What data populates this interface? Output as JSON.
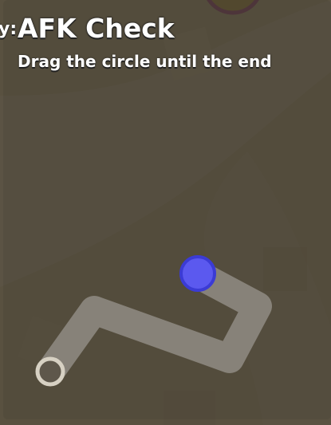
{
  "afk_check": {
    "left_fragment": "y:",
    "title": "AFK Check",
    "instruction": "Drag the circle until the end"
  },
  "colors": {
    "path": "#8a857c",
    "end_marker_fill": "#5e574b",
    "end_marker_stroke": "#d7d1c3",
    "handle_fill": "#5b59ef",
    "handle_stroke": "#3b3bd5",
    "overlay": "rgba(45, 40, 30, 0.72)"
  },
  "icons": {
    "handle": "blue-circle-icon",
    "end": "finish-circle-icon"
  }
}
